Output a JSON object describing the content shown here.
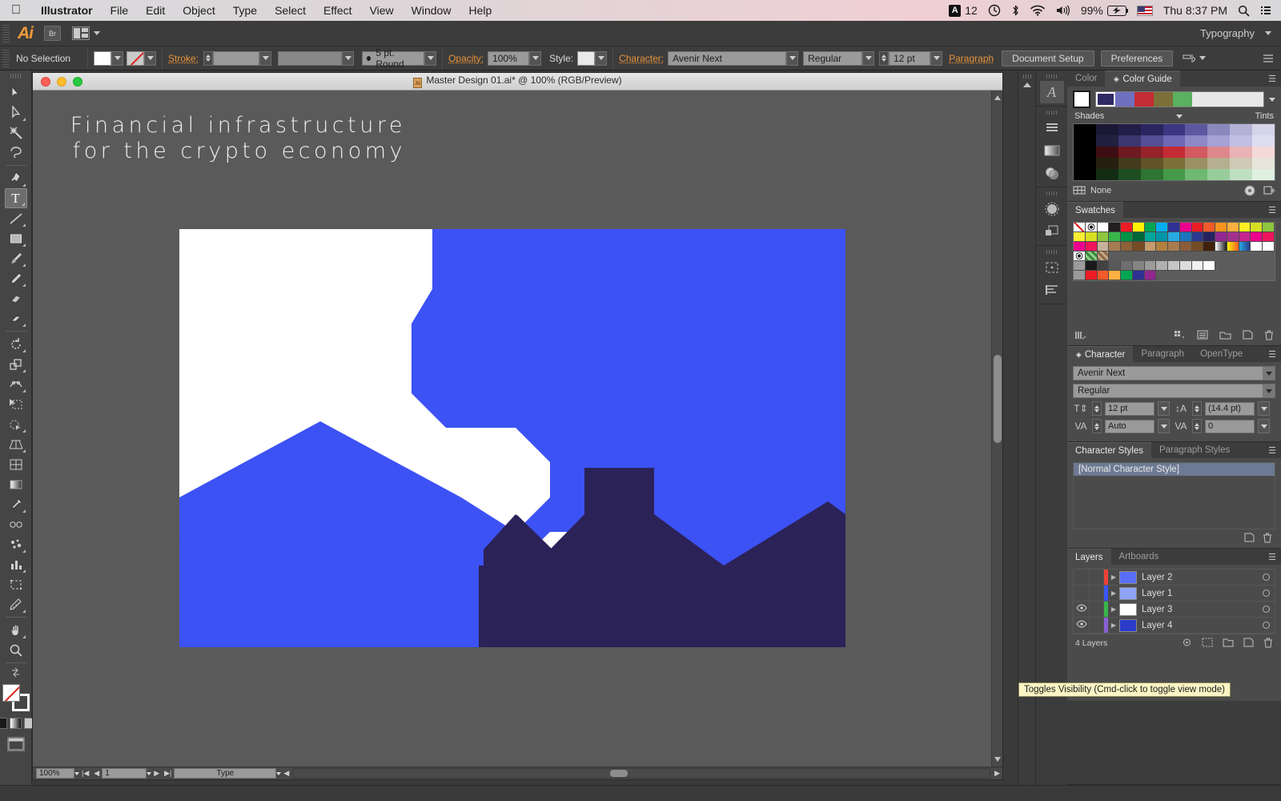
{
  "macos": {
    "apple_icon": "apple-icon",
    "menus": [
      "Illustrator",
      "File",
      "Edit",
      "Object",
      "Type",
      "Select",
      "Effect",
      "View",
      "Window",
      "Help"
    ],
    "status": {
      "adobe_count": "12",
      "adobe_badge": "A",
      "battery_percent": "99%",
      "datetime": "Thu 8:37 PM",
      "icons": [
        "adobe-icon",
        "time-machine-icon",
        "bluetooth-icon",
        "wifi-icon",
        "volume-icon",
        "battery-icon",
        "flag-icon",
        "spotlight-search-icon",
        "notification-center-icon"
      ]
    }
  },
  "appbar": {
    "logo": "Ai",
    "bridge_label": "Br",
    "arrange_label": "arrange-documents-icon",
    "workspace": "Typography"
  },
  "controlbar": {
    "selection_status": "No Selection",
    "fill_label": "fill-swatch",
    "stroke_swatch_label": "stroke-swatch",
    "stroke_label": "Stroke:",
    "stroke_weight": "",
    "stroke_profile": "",
    "brush_definition": "5 pt. Round",
    "opacity_label": "Opacity:",
    "opacity_value": "100%",
    "style_label": "Style:",
    "character_label": "Character:",
    "font_family": "Avenir Next",
    "font_style": "Regular",
    "font_size": "12 pt",
    "paragraph_label": "Paragraph",
    "document_setup": "Document Setup",
    "preferences": "Preferences"
  },
  "tools": [
    {
      "name": "selection-tool",
      "glyph": "selection"
    },
    {
      "name": "direct-selection-tool",
      "glyph": "direct"
    },
    {
      "name": "magic-wand-tool",
      "glyph": "wand"
    },
    {
      "name": "lasso-tool",
      "glyph": "lasso"
    },
    {
      "name": "pen-tool",
      "glyph": "pen"
    },
    {
      "name": "type-tool",
      "glyph": "T",
      "active": true
    },
    {
      "name": "line-segment-tool",
      "glyph": "line"
    },
    {
      "name": "rectangle-tool",
      "glyph": "rect"
    },
    {
      "name": "paintbrush-tool",
      "glyph": "brush"
    },
    {
      "name": "pencil-tool",
      "glyph": "pencil"
    },
    {
      "name": "blob-brush-tool",
      "glyph": "blob"
    },
    {
      "name": "eraser-tool",
      "glyph": "eraser"
    },
    {
      "name": "rotate-tool",
      "glyph": "rotate"
    },
    {
      "name": "scale-tool",
      "glyph": "scale"
    },
    {
      "name": "width-tool",
      "glyph": "width"
    },
    {
      "name": "free-transform-tool",
      "glyph": "transform"
    },
    {
      "name": "shape-builder-tool",
      "glyph": "shapebuilder"
    },
    {
      "name": "perspective-grid-tool",
      "glyph": "perspective"
    },
    {
      "name": "mesh-tool",
      "glyph": "mesh"
    },
    {
      "name": "gradient-tool",
      "glyph": "gradient"
    },
    {
      "name": "eyedropper-tool",
      "glyph": "eyedropper"
    },
    {
      "name": "blend-tool",
      "glyph": "blend"
    },
    {
      "name": "symbol-sprayer-tool",
      "glyph": "symbol"
    },
    {
      "name": "column-graph-tool",
      "glyph": "graph"
    },
    {
      "name": "artboard-tool",
      "glyph": "artboard"
    },
    {
      "name": "slice-tool",
      "glyph": "slice"
    },
    {
      "name": "hand-tool",
      "glyph": "hand"
    },
    {
      "name": "zoom-tool",
      "glyph": "zoom"
    }
  ],
  "document": {
    "title": "Master Design 01.ai* @ 100% (RGB/Preview)",
    "headline": "Financial infrastructure for the crypto economy",
    "artwork_colors": {
      "white": "#ffffff",
      "blue": "#3c52f4",
      "navy": "#2b2258"
    },
    "status": {
      "zoom": "100%",
      "artboard_number": "1",
      "status_text": "Type"
    }
  },
  "panels": {
    "color_guide": {
      "tabs": [
        "Color",
        "Color Guide"
      ],
      "active_tab": "Color Guide",
      "shades_label": "Shades",
      "tints_label": "Tints",
      "none_label": "None",
      "base_color": "#ffffff",
      "harmony": [
        "#2f2a63",
        "#6f6fc0",
        "#c42b34",
        "#7c7038",
        "#5bb15f"
      ],
      "grid_rows": [
        [
          "#000000",
          "#1b1836",
          "#221e47",
          "#2b2660",
          "#3d3781",
          "#5d58a0",
          "#8b88bd",
          "#b3b1d6",
          "#d6d4e9"
        ],
        [
          "#000000",
          "#231f3f",
          "#3c3770",
          "#544e96",
          "#6e68b4",
          "#8d88c6",
          "#a6a2d4",
          "#c2bfe2",
          "#dedcef"
        ],
        [
          "#000000",
          "#3d0f12",
          "#6e1a20",
          "#96222a",
          "#c42b34",
          "#d25a60",
          "#de888c",
          "#e9b3b6",
          "#f4d9da"
        ],
        [
          "#000000",
          "#241f0f",
          "#433b1c",
          "#605428",
          "#7c7038",
          "#9a9064",
          "#b6ae90",
          "#cfcab5",
          "#e7e4da"
        ],
        [
          "#000000",
          "#122d14",
          "#1f4e22",
          "#2f7434",
          "#45994a",
          "#6fb873",
          "#98cd9b",
          "#bfdfc1",
          "#dfefe0"
        ]
      ]
    },
    "swatches": {
      "title": "Swatches",
      "rows": [
        [
          "none",
          "registration",
          "#ffffff",
          "#231f20",
          "#ed1c24",
          "#fff200",
          "#00a651",
          "#00aeef",
          "#2e3192",
          "#ec008c",
          "#ed1c24",
          "#f15a29",
          "#f7941e",
          "#fbb040",
          "#fcee21",
          "#d7df23",
          "#8dc63f"
        ],
        [
          "#f9ed32",
          "#d7df23",
          "#8dc63f",
          "#39b54a",
          "#009444",
          "#006838",
          "#00a79d",
          "#0095a8",
          "#27aae1",
          "#1c75bc",
          "#2b3990",
          "#262262",
          "#92278f",
          "#a4308e",
          "#c4258f",
          "#ec008c",
          "#ed145b"
        ],
        [
          "#ec008c",
          "#ed145b",
          "#c7b299",
          "#a67c52",
          "#8c6239",
          "#754c24",
          "#c69c6d",
          "#b3813f",
          "#a97c50",
          "#8a5d3b",
          "#754c24",
          "#42210b",
          "gradient-white",
          "gradient-orange",
          "gradient-blue",
          "#ffffff",
          "#ffffff"
        ],
        [
          "registration2",
          "pattern-green",
          "pattern-brown",
          "",
          "",
          "",
          "",
          "",
          "",
          "",
          "",
          "",
          "",
          "",
          "",
          "",
          ""
        ],
        [
          "folder",
          "#1a1a1a",
          "#424242",
          "#585858",
          "#6e6e6e",
          "#848484",
          "#9a9a9a",
          "#b0b0b0",
          "#c6c6c6",
          "#dcdcdc",
          "#f0f0f0",
          "#ffffff",
          "",
          "",
          "",
          "",
          ""
        ],
        [
          "folder",
          "#ed1c24",
          "#f15a29",
          "#fbb040",
          "#00a651",
          "#2e3192",
          "#92278f",
          "",
          "",
          "",
          "",
          "",
          "",
          "",
          "",
          "",
          ""
        ]
      ]
    },
    "character": {
      "tabs": [
        "Character",
        "Paragraph",
        "OpenType"
      ],
      "active_tab": "Character",
      "font_family": "Avenir Next",
      "font_style": "Regular",
      "font_size": "12 pt",
      "leading": "(14.4 pt)",
      "kerning": "Auto",
      "tracking": "0"
    },
    "character_styles": {
      "tabs": [
        "Character Styles",
        "Paragraph Styles"
      ],
      "active_tab": "Character Styles",
      "items": [
        "[Normal Character Style]"
      ]
    },
    "layers": {
      "tabs": [
        "Layers",
        "Artboards"
      ],
      "active_tab": "Layers",
      "rows": [
        {
          "name": "Layer 2",
          "color": "#ef4136",
          "visible": false,
          "thumb": "#5a6ef5"
        },
        {
          "name": "Layer 1",
          "color": "#3b55f0",
          "visible": false,
          "thumb": "#8ea4f7"
        },
        {
          "name": "Layer 3",
          "color": "#39b54a",
          "visible": true,
          "thumb": "#ffffff"
        },
        {
          "name": "Layer 4",
          "color": "#8a5fd6",
          "visible": true,
          "thumb": "#2b3cc9"
        }
      ],
      "count_label": "4 Layers"
    }
  },
  "tooltip": {
    "text": "Toggles Visibility (Cmd-click to toggle view mode)"
  }
}
